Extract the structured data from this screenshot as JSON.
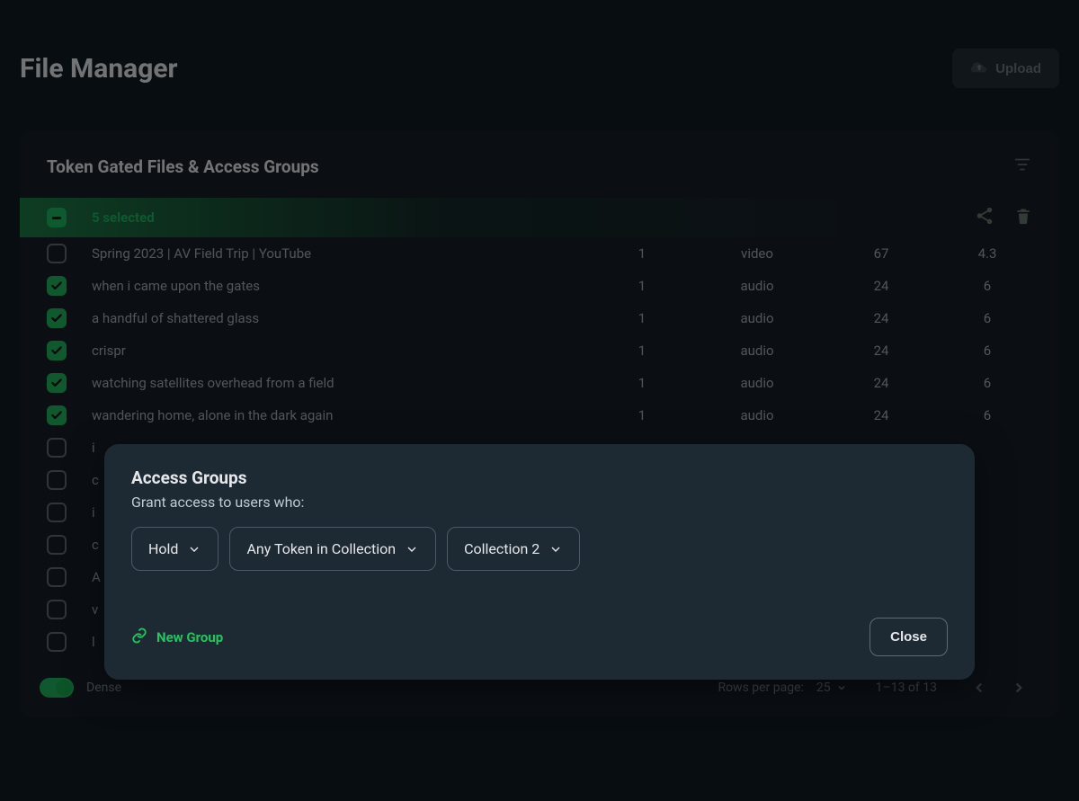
{
  "header": {
    "title": "File Manager",
    "upload_label": "Upload"
  },
  "card": {
    "title": "Token Gated Files & Access Groups",
    "selection_label": "5 selected"
  },
  "rows": [
    {
      "checked": false,
      "name": "Spring 2023 | AV Field Trip | YouTube",
      "c1": "1",
      "c2": "video",
      "c3": "67",
      "c4": "4.3"
    },
    {
      "checked": true,
      "name": "when i came upon the gates",
      "c1": "1",
      "c2": "audio",
      "c3": "24",
      "c4": "6"
    },
    {
      "checked": true,
      "name": "a handful of shattered glass",
      "c1": "1",
      "c2": "audio",
      "c3": "24",
      "c4": "6"
    },
    {
      "checked": true,
      "name": "crispr",
      "c1": "1",
      "c2": "audio",
      "c3": "24",
      "c4": "6"
    },
    {
      "checked": true,
      "name": "watching satellites overhead from a field",
      "c1": "1",
      "c2": "audio",
      "c3": "24",
      "c4": "6"
    },
    {
      "checked": true,
      "name": "wandering home, alone in the dark again",
      "c1": "1",
      "c2": "audio",
      "c3": "24",
      "c4": "6"
    },
    {
      "checked": false,
      "name": "i",
      "c1": "",
      "c2": "",
      "c3": "",
      "c4": ""
    },
    {
      "checked": false,
      "name": "c",
      "c1": "",
      "c2": "",
      "c3": "",
      "c4": ""
    },
    {
      "checked": false,
      "name": "i",
      "c1": "",
      "c2": "",
      "c3": "",
      "c4": ""
    },
    {
      "checked": false,
      "name": "c",
      "c1": "",
      "c2": "",
      "c3": "",
      "c4": ""
    },
    {
      "checked": false,
      "name": "A",
      "c1": "",
      "c2": "",
      "c3": "",
      "c4": ""
    },
    {
      "checked": false,
      "name": "v",
      "c1": "",
      "c2": "",
      "c3": "",
      "c4": ""
    },
    {
      "checked": false,
      "name": "l",
      "c1": "",
      "c2": "",
      "c3": "",
      "c4": ""
    }
  ],
  "footer": {
    "dense_label": "Dense",
    "rows_per_page_label": "Rows per page:",
    "rows_per_page_value": "25",
    "range_label": "1–13 of 13"
  },
  "dialog": {
    "title": "Access Groups",
    "subtitle": "Grant access to users who:",
    "dd1": "Hold",
    "dd2": "Any Token in Collection",
    "dd3": "Collection 2",
    "new_group_label": "New Group",
    "close_label": "Close"
  }
}
